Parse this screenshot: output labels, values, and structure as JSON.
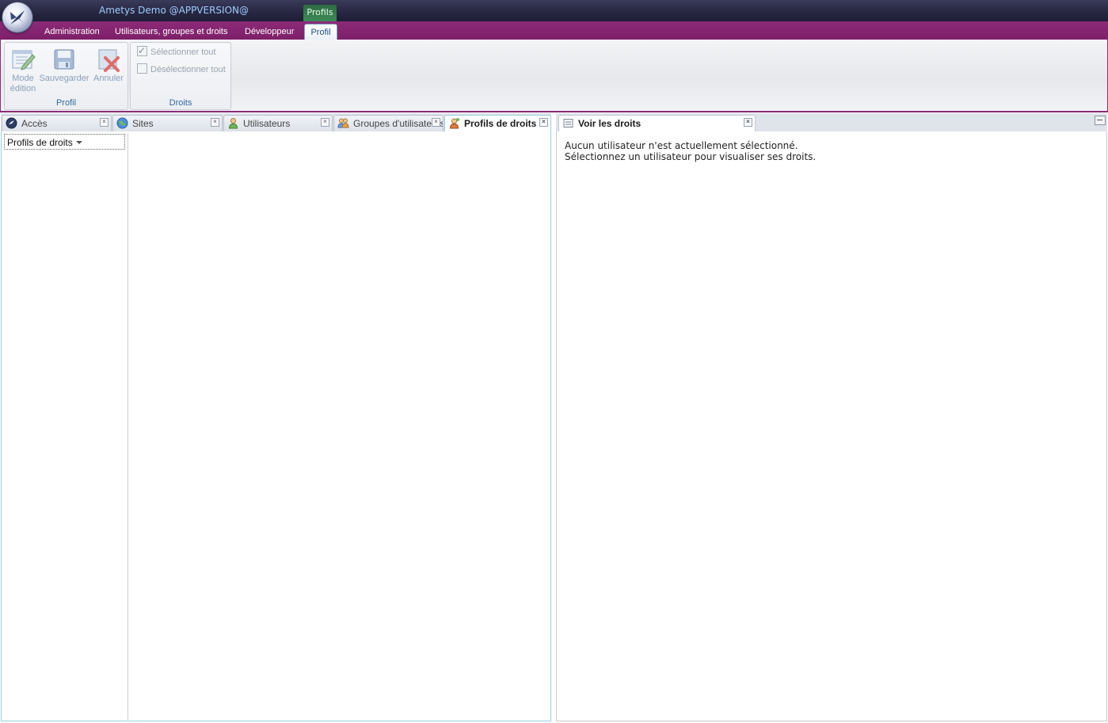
{
  "app": {
    "title": "Ametys Demo @APPVERSION@",
    "context_tab_label": "Profils"
  },
  "ribbon_tabs": [
    {
      "label": "Administration"
    },
    {
      "label": "Utilisateurs, groupes et droits"
    },
    {
      "label": "Développeur"
    },
    {
      "label": "Profil"
    }
  ],
  "ribbon": {
    "profil_group": {
      "label": "Profil",
      "edit_mode": "Mode édition",
      "edit_mode_l1": "Mode",
      "edit_mode_l2": "édition",
      "save": "Sauvegarder",
      "cancel": "Annuler"
    },
    "droits_group": {
      "label": "Droits",
      "select_all": "Sélectionner tout",
      "deselect_all": "Désélectionner tout"
    }
  },
  "left_tabs": [
    {
      "label": "Accès",
      "icon": "access-icon"
    },
    {
      "label": "Sites",
      "icon": "globe-icon"
    },
    {
      "label": "Utilisateurs",
      "icon": "user-icon"
    },
    {
      "label": "Groupes d'utilisateurs",
      "icon": "group-icon"
    },
    {
      "label": "Profils de droits",
      "icon": "profile-icon",
      "active": true
    }
  ],
  "profiles_panel": {
    "header": "Profils de droits"
  },
  "rights_panel": {
    "tab_label": "Voir les droits",
    "message_line1": "Aucun utilisateur n'est actuellement sélectionné.",
    "message_line2": "Sélectionnez un utilisateur pour visualiser ses droits."
  },
  "colors": {
    "ribbon_purple": "#8c2a78",
    "title_bar": "#262640",
    "accent_blue": "#99cde0",
    "context_green": "#3c8a57"
  }
}
